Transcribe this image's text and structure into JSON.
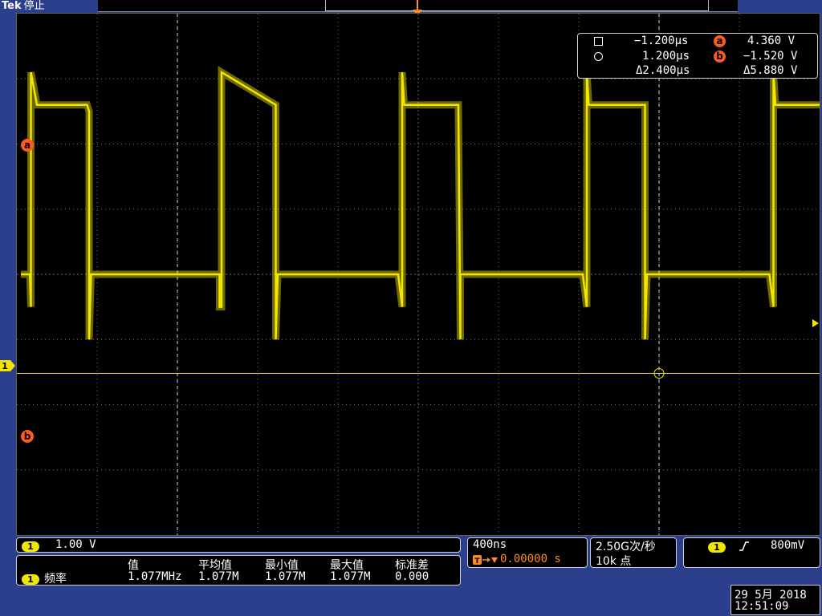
{
  "header": {
    "brand": "Tek",
    "acquisition_status": "停止"
  },
  "trigger_marker": "T",
  "cursors": {
    "cursor1_time": "−1.200µs",
    "cursor2_time": "1.200µs",
    "delta_time": "Δ2.400µs",
    "cursor_a_label": "a",
    "cursor_a_voltage": "4.360 V",
    "cursor_b_label": "b",
    "cursor_b_voltage": "−1.520 V",
    "delta_voltage": "Δ5.880 V"
  },
  "channel_marker": "1",
  "channel": {
    "label": "1",
    "scale": "1.00 V",
    "color": "#f2e600"
  },
  "measurements": {
    "headers": [
      "值",
      "平均值",
      "最小值",
      "最大值",
      "标准差"
    ],
    "row": {
      "channel": "1",
      "name": "频率",
      "value": "1.077MHz",
      "mean": "1.077M",
      "min": "1.077M",
      "max": "1.077M",
      "std": "0.000"
    }
  },
  "timebase": {
    "scale": "400ns",
    "trigger_position": "0.00000 s"
  },
  "acquisition": {
    "sample_rate": "2.50G次/秒",
    "record_length": "10k 点"
  },
  "trigger": {
    "source": "1",
    "slope_icon": "rising-edge-icon",
    "level": "800mV"
  },
  "datetime": {
    "date": "29 5月 2018",
    "time": "12:51:09"
  },
  "colors": {
    "background": "#2b3f8c",
    "trace": "#f2e600",
    "cursor_badge": "#ff5a1f"
  },
  "chart_data": {
    "type": "line",
    "title": "",
    "xlabel": "",
    "ylabel": "",
    "x_unit": "s",
    "y_unit": "V",
    "xlim": [
      -2e-06,
      2e-06
    ],
    "ylim": [
      -4.0,
      4.0
    ],
    "grid": true,
    "series": [
      {
        "x": [
          -1.98e-06,
          -1.935e-06,
          -1.93e-06,
          -1.93e-06,
          -1.9e-06,
          -1.65e-06,
          -1.64e-06,
          -1.64e-06,
          -1.63e-06,
          -1.01e-06,
          -9.9e-07,
          -9.9e-07,
          -9.8e-07,
          -9.8e-07,
          -7.1e-07,
          -7.1e-07,
          -7e-07,
          -7e-07,
          -1e-07,
          -8e-08,
          -8e-08,
          -7e-08,
          -6e-08,
          2e-07,
          2.1e-07,
          2.1e-07,
          2.2e-07,
          8.2e-07,
          8.4e-07,
          8.4e-07,
          8.5e-07,
          8.6e-07,
          1.13e-06,
          1.13e-06,
          1.14e-06,
          1.14e-06,
          1.75e-06,
          1.77e-06,
          1.77e-06,
          1.78e-06,
          1.79e-06,
          2e-06
        ],
        "y": [
          0.0,
          0.0,
          -0.5,
          3.1,
          2.6,
          2.6,
          2.5,
          -1.0,
          0.0,
          0.0,
          0.0,
          -0.5,
          -0.5,
          3.1,
          2.6,
          -1.0,
          0.0,
          0.0,
          0.0,
          -0.5,
          3.1,
          2.6,
          2.6,
          2.6,
          -1.0,
          0.0,
          0.0,
          0.0,
          -0.5,
          3.1,
          2.6,
          2.6,
          2.6,
          -1.0,
          0.0,
          0.0,
          0.0,
          -0.5,
          3.1,
          2.6,
          2.6,
          2.6
        ]
      }
    ],
    "cursor_lines": {
      "vertical_times": [
        -1.2e-06,
        1.2e-06
      ],
      "horizontal_voltages": [
        4.36,
        -1.52
      ]
    }
  }
}
